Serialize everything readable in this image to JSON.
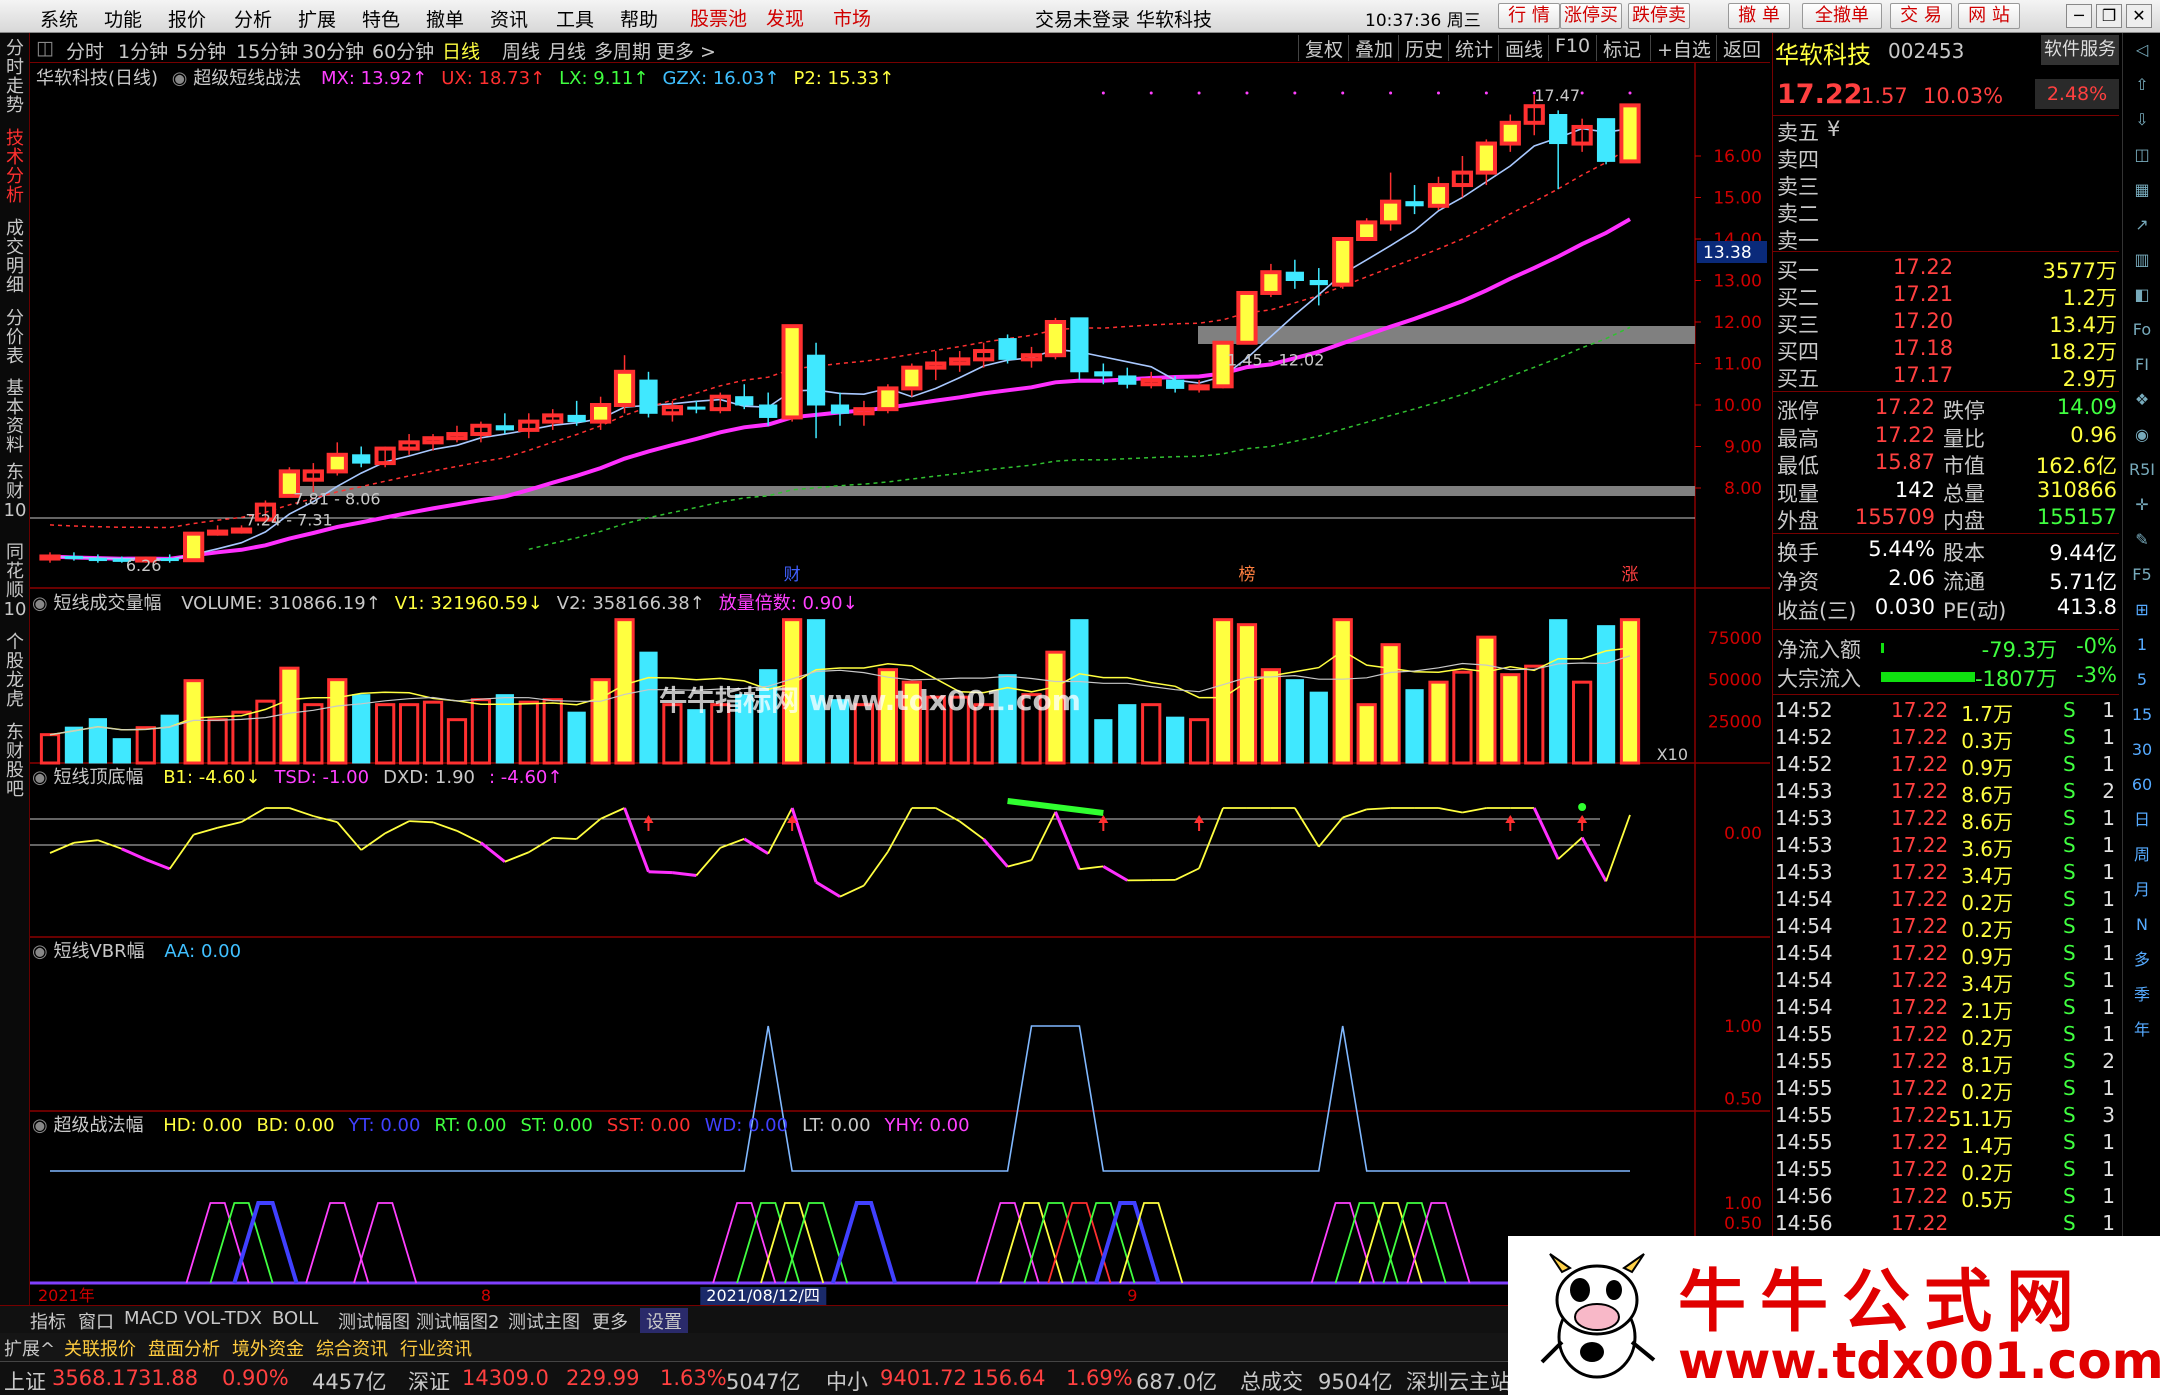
{
  "menu": {
    "items": [
      "系统",
      "功能",
      "报价",
      "分析",
      "扩展",
      "特色",
      "撤单",
      "资讯",
      "工具",
      "帮助"
    ],
    "red_items": [
      "股票池",
      "发现",
      "市场"
    ],
    "center_title": "交易未登录  华软科技",
    "clock": "10:37:36 周三",
    "buttons": [
      "行  情",
      "涨停买",
      "跌停卖",
      "撤  单",
      "全撤单",
      "交  易",
      "网  站"
    ]
  },
  "left_tabs": [
    {
      "label": "分时走势",
      "active": false
    },
    {
      "label": "技术分析",
      "active": true
    },
    {
      "label": "成交明细",
      "active": false
    },
    {
      "label": "分价表",
      "active": false
    },
    {
      "label": "基本资料",
      "active": false
    },
    {
      "label": "东财10",
      "active": false
    },
    {
      "label": "同花顺10",
      "active": false
    },
    {
      "label": "个股龙虎",
      "active": false
    },
    {
      "label": "东财股吧",
      "active": false
    }
  ],
  "periods": {
    "items": [
      "分时",
      "1分钟",
      "5分钟",
      "15分钟",
      "30分钟",
      "60分钟",
      "日线",
      "周线",
      "月线",
      "多周期",
      "更多 >"
    ],
    "selected": "日线"
  },
  "toolbar": [
    "复权",
    "叠加",
    "历史",
    "统计",
    "画线",
    "F10",
    "标记",
    "+自选",
    "返回"
  ],
  "main_panel": {
    "stock": "华软科技(日线)",
    "formula": "超级短线战法",
    "values": [
      {
        "label": "MX: 13.92↑",
        "color": "#ff40ff"
      },
      {
        "label": "UX: 18.73↑",
        "color": "#ff3030"
      },
      {
        "label": "LX: 9.11↑",
        "color": "#40ff40"
      },
      {
        "label": "GZX: 16.03↑",
        "color": "#40c0ff"
      },
      {
        "label": "P2: 15.33↑",
        "color": "#ffff40"
      }
    ],
    "axis": [
      "16.00",
      "15.00",
      "14.00",
      "13.00",
      "12.00",
      "11.00",
      "10.00",
      "9.00",
      "8.00"
    ],
    "current_price_tag": "13.38",
    "annotations": [
      "17.47",
      "1.45 - 12.02",
      "7.81 - 8.06",
      "7.24 - 7.31",
      "6.26"
    ],
    "markers": [
      "财",
      "榜",
      "涨"
    ]
  },
  "volume_panel": {
    "title": "短线成交量幅",
    "values": [
      {
        "label": "VOLUME: 310866.19↑",
        "color": "#c8c8c8"
      },
      {
        "label": "V1: 321960.59↓",
        "color": "#ffff40"
      },
      {
        "label": "V2: 358166.38↑",
        "color": "#c8c8c8"
      },
      {
        "label": "放量倍数: 0.90↓",
        "color": "#ff40ff"
      }
    ],
    "axis": [
      "75000",
      "50000",
      "25000"
    ],
    "multiplier": "X10",
    "watermark": "牛牛指标网 www.tdx001.com"
  },
  "ind1_panel": {
    "title": "短线顶底幅",
    "values": [
      {
        "label": "B1: -4.60↓",
        "color": "#ffff40"
      },
      {
        "label": "TSD: -1.00",
        "color": "#ff40ff"
      },
      {
        "label": "DXD: 1.90",
        "color": "#c8c8c8"
      },
      {
        "label": ": -4.60↑",
        "color": "#ff40ff"
      }
    ],
    "axis": [
      "0.00"
    ]
  },
  "ind2_panel": {
    "title": "短线VBR幅",
    "values": [
      {
        "label": "AA: 0.00",
        "color": "#40c0ff"
      }
    ],
    "axis": [
      "1.00",
      "0.50"
    ]
  },
  "ind3_panel": {
    "title": "超级战法幅",
    "values": [
      {
        "label": "HD: 0.00",
        "color": "#ffff40"
      },
      {
        "label": "BD: 0.00",
        "color": "#ffff40"
      },
      {
        "label": "YT: 0.00",
        "color": "#4040ff"
      },
      {
        "label": "RT: 0.00",
        "color": "#40ff40"
      },
      {
        "label": "ST: 0.00",
        "color": "#40ff40"
      },
      {
        "label": "SST: 0.00",
        "color": "#ff3030"
      },
      {
        "label": "WD: 0.00",
        "color": "#4040ff"
      },
      {
        "label": "LT: 0.00",
        "color": "#c8c8c8"
      },
      {
        "label": "YHY: 0.00",
        "color": "#ff40ff"
      }
    ],
    "axis": [
      "1.00",
      "0.50"
    ]
  },
  "date_axis": [
    "2021年",
    "8",
    "2021/08/12/四",
    "9"
  ],
  "bottom_tabs": [
    "指标",
    "窗口",
    "MACD",
    "VOL-TDX",
    "BOLL",
    "测试幅图",
    "测试幅图2",
    "测试主图",
    "更多",
    "设置"
  ],
  "bottom_tabs2": [
    "扩展^",
    "关联报价",
    "盘面分析",
    "境外资金",
    "综合资讯",
    "行业资讯"
  ],
  "quote": {
    "name": "华软科技",
    "code": "002453",
    "service": "软件服务",
    "price": "17.22",
    "change": "1.57",
    "pct": "10.03%",
    "extra": "2.48%",
    "asks": [
      {
        "label": "卖五",
        "price": "¥",
        "vol": ""
      },
      {
        "label": "卖四",
        "price": "",
        "vol": ""
      },
      {
        "label": "卖三",
        "price": "",
        "vol": ""
      },
      {
        "label": "卖二",
        "price": "",
        "vol": ""
      },
      {
        "label": "卖一",
        "price": "",
        "vol": ""
      }
    ],
    "bids": [
      {
        "label": "买一",
        "price": "17.22",
        "vol": "3577万"
      },
      {
        "label": "买二",
        "price": "17.21",
        "vol": "1.2万"
      },
      {
        "label": "买三",
        "price": "17.20",
        "vol": "13.4万"
      },
      {
        "label": "买四",
        "price": "17.18",
        "vol": "18.2万"
      },
      {
        "label": "买五",
        "price": "17.17",
        "vol": "2.9万"
      }
    ],
    "stats": [
      {
        "l1": "涨停",
        "v1": "17.22",
        "l2": "跌停",
        "v2": "14.09"
      },
      {
        "l1": "最高",
        "v1": "17.22",
        "l2": "量比",
        "v2": "0.96"
      },
      {
        "l1": "最低",
        "v1": "15.87",
        "l2": "市值",
        "v2": "162.6亿"
      },
      {
        "l1": "现量",
        "v1": "142",
        "l2": "总量",
        "v2": "310866"
      },
      {
        "l1": "外盘",
        "v1": "155709",
        "l2": "内盘",
        "v2": "155157"
      }
    ],
    "stats2": [
      {
        "l1": "换手",
        "v1": "5.44%",
        "l2": "股本",
        "v2": "9.44亿"
      },
      {
        "l1": "净资",
        "v1": "2.06",
        "l2": "流通",
        "v2": "5.71亿"
      },
      {
        "l1": "收益(三)",
        "v1": "0.030",
        "l2": "PE(动)",
        "v2": "413.8"
      }
    ],
    "flows": [
      {
        "label": "净流入额",
        "value": "-79.3万",
        "pct": "-0%",
        "fill": 0.01
      },
      {
        "label": "大宗流入",
        "value": "-1807万",
        "pct": "-3%",
        "fill": 0.85
      }
    ]
  },
  "ticks": [
    {
      "t": "14:52",
      "p": "17.22",
      "v": "1.7万",
      "s": "S",
      "n": "1"
    },
    {
      "t": "14:52",
      "p": "17.22",
      "v": "0.3万",
      "s": "S",
      "n": "1"
    },
    {
      "t": "14:52",
      "p": "17.22",
      "v": "0.9万",
      "s": "S",
      "n": "1"
    },
    {
      "t": "14:53",
      "p": "17.22",
      "v": "8.6万",
      "s": "S",
      "n": "2"
    },
    {
      "t": "14:53",
      "p": "17.22",
      "v": "8.6万",
      "s": "S",
      "n": "1"
    },
    {
      "t": "14:53",
      "p": "17.22",
      "v": "3.6万",
      "s": "S",
      "n": "1"
    },
    {
      "t": "14:53",
      "p": "17.22",
      "v": "3.4万",
      "s": "S",
      "n": "1"
    },
    {
      "t": "14:54",
      "p": "17.22",
      "v": "0.2万",
      "s": "S",
      "n": "1"
    },
    {
      "t": "14:54",
      "p": "17.22",
      "v": "0.2万",
      "s": "S",
      "n": "1"
    },
    {
      "t": "14:54",
      "p": "17.22",
      "v": "0.9万",
      "s": "S",
      "n": "1"
    },
    {
      "t": "14:54",
      "p": "17.22",
      "v": "3.4万",
      "s": "S",
      "n": "1"
    },
    {
      "t": "14:54",
      "p": "17.22",
      "v": "2.1万",
      "s": "S",
      "n": "1"
    },
    {
      "t": "14:55",
      "p": "17.22",
      "v": "0.2万",
      "s": "S",
      "n": "1"
    },
    {
      "t": "14:55",
      "p": "17.22",
      "v": "8.1万",
      "s": "S",
      "n": "2"
    },
    {
      "t": "14:55",
      "p": "17.22",
      "v": "0.2万",
      "s": "S",
      "n": "1"
    },
    {
      "t": "14:55",
      "p": "17.22",
      "v": "51.1万",
      "s": "S",
      "n": "3"
    },
    {
      "t": "14:55",
      "p": "17.22",
      "v": "1.4万",
      "s": "S",
      "n": "1"
    },
    {
      "t": "14:55",
      "p": "17.22",
      "v": "0.2万",
      "s": "S",
      "n": "1"
    },
    {
      "t": "14:56",
      "p": "17.22",
      "v": "0.5万",
      "s": "S",
      "n": "1"
    },
    {
      "t": "14:56",
      "p": "17.22",
      "v": "",
      "s": "S",
      "n": "1"
    }
  ],
  "right_tools": [
    "◁",
    "⇧",
    "⇩",
    "◫",
    "▦",
    "↗",
    "▥",
    "◧",
    "Fo",
    "FI",
    "❖",
    "◉",
    "R5I",
    "✛",
    "✎",
    "F5",
    "⊞",
    "1",
    "5",
    "15",
    "30",
    "60",
    "日",
    "周",
    "月",
    "N",
    "多",
    "季",
    "年"
  ],
  "status": [
    {
      "text": "上证",
      "c": "#c8c8c8"
    },
    {
      "text": "3568.17",
      "c": "#ff4040"
    },
    {
      "text": "31.88",
      "c": "#ff4040"
    },
    {
      "text": "0.90%",
      "c": "#ff4040"
    },
    {
      "text": "4457亿",
      "c": "#c8c8c8"
    },
    {
      "text": "深证",
      "c": "#c8c8c8"
    },
    {
      "text": "14309.0",
      "c": "#ff4040"
    },
    {
      "text": "229.99",
      "c": "#ff4040"
    },
    {
      "text": "1.63%",
      "c": "#ff4040"
    },
    {
      "text": "5047亿",
      "c": "#c8c8c8"
    },
    {
      "text": "中小",
      "c": "#c8c8c8"
    },
    {
      "text": "9401.72",
      "c": "#ff4040"
    },
    {
      "text": "156.64",
      "c": "#ff4040"
    },
    {
      "text": "1.69%",
      "c": "#ff4040"
    },
    {
      "text": "687.0亿",
      "c": "#c8c8c8"
    },
    {
      "text": "总成交",
      "c": "#c8c8c8"
    },
    {
      "text": "9504亿",
      "c": "#c8c8c8"
    },
    {
      "text": "深圳云主站",
      "c": "#c8c8c8"
    }
  ],
  "ad": {
    "title": "牛牛公式网",
    "url": "www.tdx001.com"
  },
  "colors": {
    "up": "#ff3030",
    "down": "#40e8ff",
    "yellow": "#ffff40",
    "magenta": "#ff40ff"
  },
  "candles": [
    {
      "o": 6.3,
      "h": 6.45,
      "l": 6.2,
      "c": 6.35
    },
    {
      "o": 6.35,
      "h": 6.45,
      "l": 6.25,
      "c": 6.3
    },
    {
      "o": 6.3,
      "h": 6.4,
      "l": 6.2,
      "c": 6.28
    },
    {
      "o": 6.28,
      "h": 6.35,
      "l": 6.2,
      "c": 6.26
    },
    {
      "o": 6.26,
      "h": 6.35,
      "l": 6.2,
      "c": 6.3
    },
    {
      "o": 6.3,
      "h": 6.4,
      "l": 6.2,
      "c": 6.26
    },
    {
      "o": 6.26,
      "h": 6.9,
      "l": 6.26,
      "c": 6.9
    },
    {
      "o": 6.9,
      "h": 7.1,
      "l": 6.85,
      "c": 6.95
    },
    {
      "o": 6.95,
      "h": 7.1,
      "l": 6.9,
      "c": 7.0
    },
    {
      "o": 7.24,
      "h": 7.7,
      "l": 7.24,
      "c": 7.6
    },
    {
      "o": 7.81,
      "h": 8.5,
      "l": 7.81,
      "c": 8.4
    },
    {
      "o": 8.2,
      "h": 8.6,
      "l": 7.9,
      "c": 8.4
    },
    {
      "o": 8.4,
      "h": 9.1,
      "l": 8.3,
      "c": 8.8
    },
    {
      "o": 8.8,
      "h": 9.0,
      "l": 8.5,
      "c": 8.6
    },
    {
      "o": 8.6,
      "h": 9.0,
      "l": 8.5,
      "c": 8.95
    },
    {
      "o": 8.95,
      "h": 9.3,
      "l": 8.8,
      "c": 9.1
    },
    {
      "o": 9.1,
      "h": 9.3,
      "l": 8.9,
      "c": 9.2
    },
    {
      "o": 9.2,
      "h": 9.5,
      "l": 9.1,
      "c": 9.3
    },
    {
      "o": 9.3,
      "h": 9.6,
      "l": 9.1,
      "c": 9.5
    },
    {
      "o": 9.5,
      "h": 9.8,
      "l": 9.3,
      "c": 9.4
    },
    {
      "o": 9.4,
      "h": 9.8,
      "l": 9.2,
      "c": 9.6
    },
    {
      "o": 9.6,
      "h": 9.9,
      "l": 9.4,
      "c": 9.75
    },
    {
      "o": 9.75,
      "h": 10.1,
      "l": 9.5,
      "c": 9.6
    },
    {
      "o": 9.6,
      "h": 10.2,
      "l": 9.4,
      "c": 10.0
    },
    {
      "o": 10.0,
      "h": 11.2,
      "l": 9.8,
      "c": 10.8
    },
    {
      "o": 10.6,
      "h": 10.8,
      "l": 9.7,
      "c": 9.8
    },
    {
      "o": 9.8,
      "h": 10.1,
      "l": 9.6,
      "c": 9.95
    },
    {
      "o": 9.95,
      "h": 10.1,
      "l": 9.8,
      "c": 9.9
    },
    {
      "o": 9.9,
      "h": 10.3,
      "l": 9.8,
      "c": 10.2
    },
    {
      "o": 10.2,
      "h": 10.5,
      "l": 9.9,
      "c": 10.0
    },
    {
      "o": 10.0,
      "h": 10.3,
      "l": 9.5,
      "c": 9.7
    },
    {
      "o": 9.7,
      "h": 11.9,
      "l": 9.6,
      "c": 11.9
    },
    {
      "o": 11.2,
      "h": 11.5,
      "l": 9.2,
      "c": 10.0
    },
    {
      "o": 10.0,
      "h": 10.3,
      "l": 9.5,
      "c": 9.8
    },
    {
      "o": 9.8,
      "h": 10.1,
      "l": 9.5,
      "c": 9.9
    },
    {
      "o": 9.9,
      "h": 10.5,
      "l": 9.8,
      "c": 10.4
    },
    {
      "o": 10.4,
      "h": 11.0,
      "l": 10.2,
      "c": 10.9
    },
    {
      "o": 10.9,
      "h": 11.3,
      "l": 10.6,
      "c": 11.0
    },
    {
      "o": 11.0,
      "h": 11.3,
      "l": 10.8,
      "c": 11.1
    },
    {
      "o": 11.1,
      "h": 11.5,
      "l": 10.9,
      "c": 11.3
    },
    {
      "o": 11.6,
      "h": 11.7,
      "l": 11.0,
      "c": 11.1
    },
    {
      "o": 11.1,
      "h": 11.4,
      "l": 10.9,
      "c": 11.2
    },
    {
      "o": 11.2,
      "h": 12.1,
      "l": 11.1,
      "c": 12.0
    },
    {
      "o": 12.1,
      "h": 12.1,
      "l": 10.6,
      "c": 10.8
    },
    {
      "o": 10.8,
      "h": 11.0,
      "l": 10.5,
      "c": 10.7
    },
    {
      "o": 10.7,
      "h": 10.9,
      "l": 10.4,
      "c": 10.5
    },
    {
      "o": 10.5,
      "h": 10.8,
      "l": 10.4,
      "c": 10.6
    },
    {
      "o": 10.6,
      "h": 10.7,
      "l": 10.3,
      "c": 10.4
    },
    {
      "o": 10.4,
      "h": 10.6,
      "l": 10.3,
      "c": 10.45
    },
    {
      "o": 10.45,
      "h": 11.5,
      "l": 10.4,
      "c": 11.5
    },
    {
      "o": 11.5,
      "h": 12.7,
      "l": 11.5,
      "c": 12.7
    },
    {
      "o": 12.7,
      "h": 13.4,
      "l": 12.6,
      "c": 13.2
    },
    {
      "o": 13.2,
      "h": 13.5,
      "l": 12.8,
      "c": 13.0
    },
    {
      "o": 13.0,
      "h": 13.3,
      "l": 12.4,
      "c": 12.9
    },
    {
      "o": 12.9,
      "h": 14.0,
      "l": 12.8,
      "c": 14.0
    },
    {
      "o": 14.0,
      "h": 14.5,
      "l": 14.0,
      "c": 14.4
    },
    {
      "o": 14.4,
      "h": 15.6,
      "l": 14.2,
      "c": 14.9
    },
    {
      "o": 14.9,
      "h": 15.3,
      "l": 14.6,
      "c": 14.8
    },
    {
      "o": 14.8,
      "h": 15.5,
      "l": 14.7,
      "c": 15.3
    },
    {
      "o": 15.3,
      "h": 16.0,
      "l": 15.0,
      "c": 15.6
    },
    {
      "o": 15.6,
      "h": 16.4,
      "l": 15.3,
      "c": 16.3
    },
    {
      "o": 16.3,
      "h": 17.0,
      "l": 16.1,
      "c": 16.8
    },
    {
      "o": 16.8,
      "h": 17.47,
      "l": 16.5,
      "c": 17.2
    },
    {
      "o": 17.0,
      "h": 17.1,
      "l": 15.2,
      "c": 16.3
    },
    {
      "o": 16.3,
      "h": 16.9,
      "l": 16.1,
      "c": 16.7
    },
    {
      "o": 16.9,
      "h": 16.9,
      "l": 15.8,
      "c": 15.87
    },
    {
      "o": 15.87,
      "h": 17.22,
      "l": 15.87,
      "c": 17.22
    }
  ]
}
